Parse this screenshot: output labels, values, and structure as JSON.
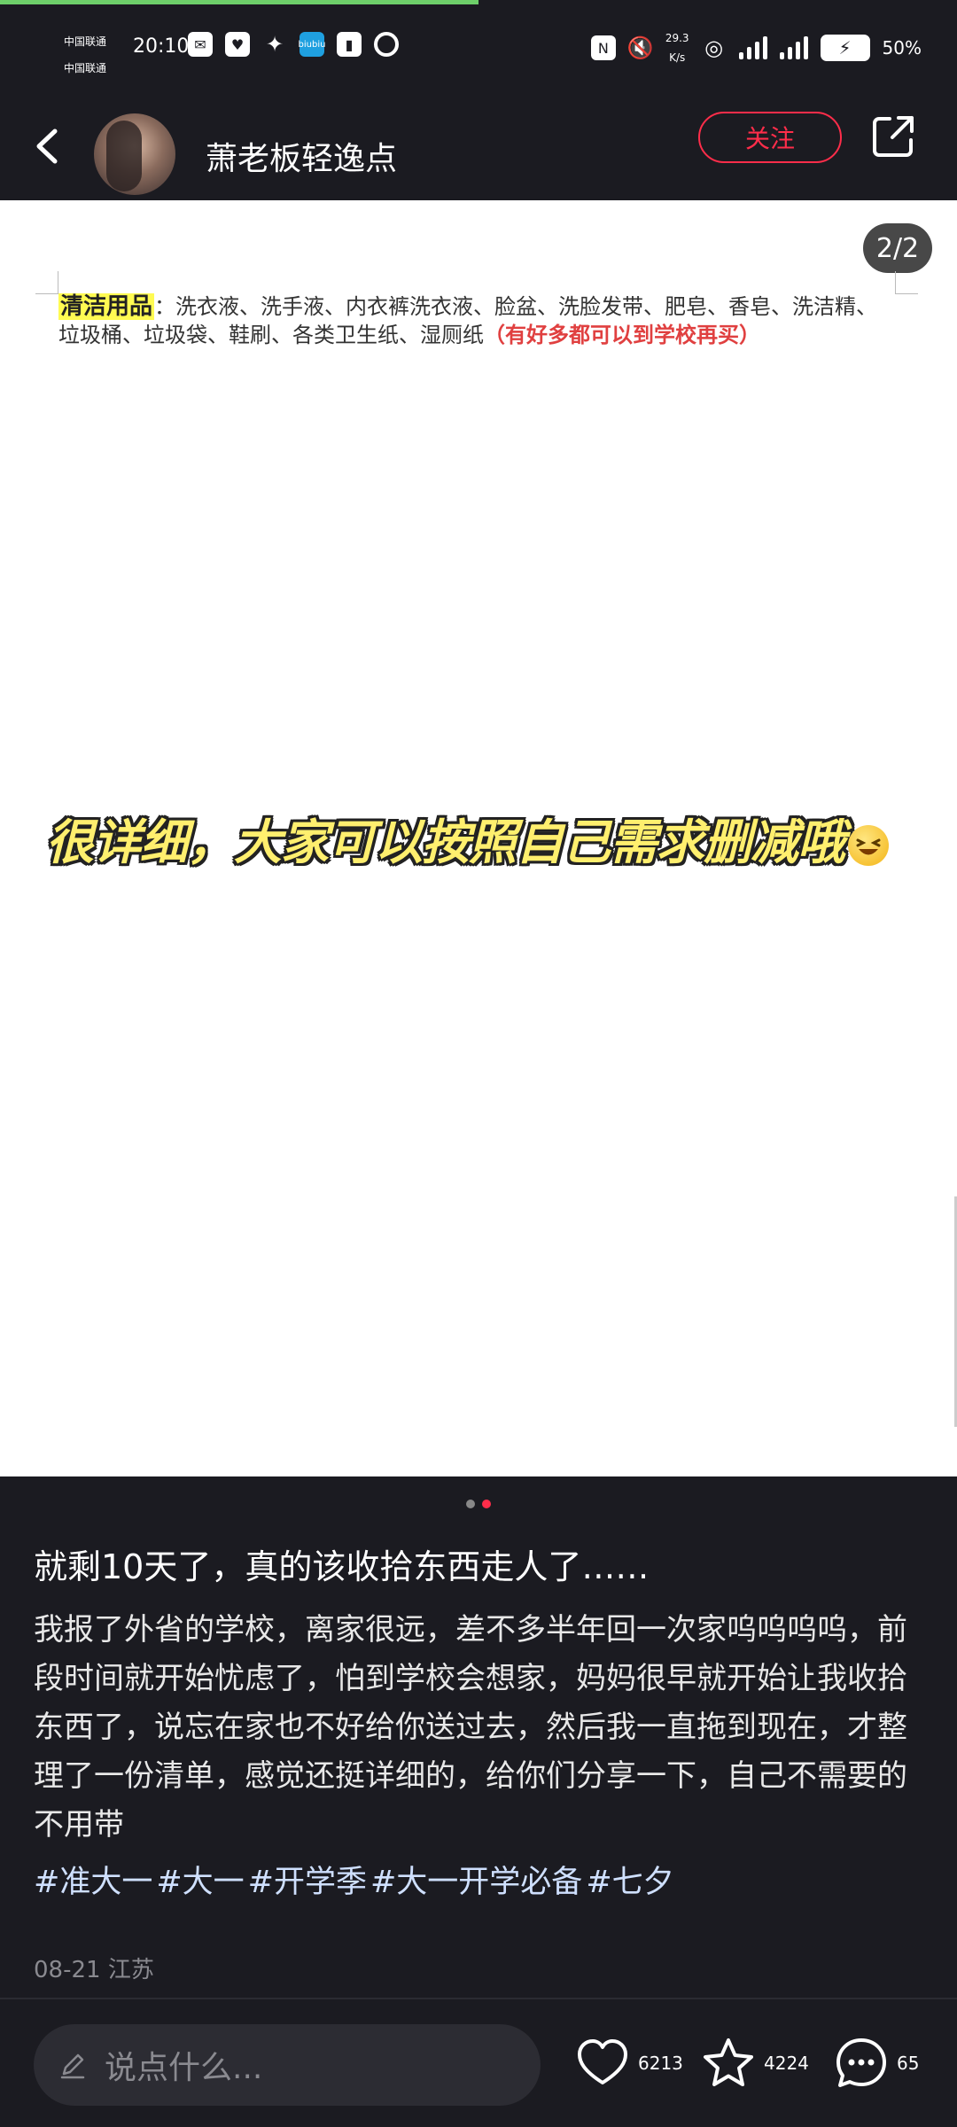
{
  "status_bar": {
    "carrier_1": "中国联通",
    "carrier_2": "中国联通",
    "time": "20:10",
    "net_speed_value": "29.3",
    "net_speed_unit": "K/s",
    "battery_percent": "50%",
    "app_icon_label": "biubiu"
  },
  "header": {
    "username": "萧老板轻逸点",
    "follow_label": "关注"
  },
  "image": {
    "page_indicator": "2/2",
    "list_title": "清洁用品",
    "list_separator": "：",
    "list_items": "洗衣液、洗手液、内衣裤洗衣液、脸盆、洗脸发带、肥皂、香皂、洗洁精、垃圾桶、垃圾袋、鞋刷、各类卫生纸、湿厕纸",
    "list_note": "（有好多都可以到学校再买）",
    "overlay_text": "很详细，大家可以按照自己需求删减哦"
  },
  "carousel": {
    "total": 2,
    "active_index": 1
  },
  "post": {
    "title": "就剩10天了，真的该收拾东西走人了……",
    "body": "我报了外省的学校，离家很远，差不多半年回一次家呜呜呜呜，前段时间就开始忧虑了，怕到学校会想家，妈妈很早就开始让我收拾东西了，说忘在家也不好给你送过去，然后我一直拖到现在，才整理了一份清单，感觉还挺详细的，给你们分享一下，自己不需要的不用带",
    "tags": [
      "#准大一",
      "#大一",
      "#开学季",
      "#大一开学必备",
      "#七夕"
    ],
    "meta": "08-21 江苏"
  },
  "bottom_bar": {
    "comment_placeholder": "说点什么...",
    "like_count": "6213",
    "fav_count": "4224",
    "comment_count": "65"
  },
  "colors": {
    "background": "#1b1b21",
    "accent_red": "#ff2d4a",
    "highlight_yellow": "#fffb52",
    "note_red": "#e04040"
  },
  "icons": [
    "back-icon",
    "share-icon",
    "pencil-icon",
    "heart-icon",
    "star-icon",
    "chat-bubble-icon",
    "laughing-emoji-icon"
  ]
}
